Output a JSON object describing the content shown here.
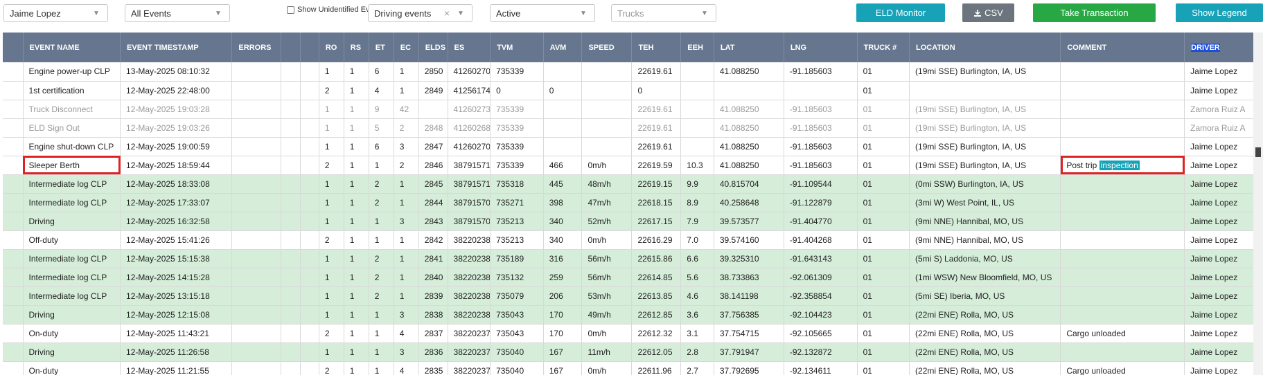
{
  "filters": {
    "driver": "Jaime Lopez",
    "events": "All Events",
    "show_unidentified_label": "Show Unidentified Events",
    "event_type": "Driving events",
    "status": "Active",
    "trucks_placeholder": "Trucks"
  },
  "buttons": {
    "eld_monitor": "ELD Monitor",
    "csv": "CSV",
    "take_transaction": "Take Transaction",
    "show_legend": "Show Legend"
  },
  "colors": {
    "header": "#66768e",
    "row_green": "#d5edd9",
    "highlight": "#d22222",
    "accent_teal": "#17a2b8",
    "accent_green": "#28a745"
  },
  "table": {
    "headers": [
      "",
      "EVENT NAME",
      "EVENT TIMESTAMP",
      "ERRORS",
      "",
      "",
      "RO",
      "RS",
      "ET",
      "EC",
      "ELDS",
      "ES",
      "TVM",
      "AVM",
      "SPEED",
      "TEH",
      "EEH",
      "LAT",
      "LNG",
      "TRUCK #",
      "LOCATION",
      "COMMENT",
      "DRIVER"
    ],
    "rows": [
      {
        "style": "white",
        "cells": [
          "",
          "Engine power-up CLP",
          "13-May-2025 08:10:32",
          "",
          "",
          "",
          "1",
          "1",
          "6",
          "1",
          "2850",
          "41260270",
          "735339",
          "",
          "",
          "22619.61",
          "",
          "41.088250",
          "-91.185603",
          "01",
          "(19mi SSE) Burlington, IA, US",
          "",
          "Jaime Lopez"
        ]
      },
      {
        "style": "white",
        "cells": [
          "",
          "1st certification",
          "12-May-2025 22:48:00",
          "",
          "",
          "",
          "2",
          "1",
          "4",
          "1",
          "2849",
          "41256174",
          "0",
          "0",
          "",
          "0",
          "",
          "",
          "",
          "01",
          "",
          "",
          "Jaime Lopez"
        ]
      },
      {
        "style": "gray",
        "cells": [
          "",
          "Truck Disconnect",
          "12-May-2025 19:03:28",
          "",
          "",
          "",
          "1",
          "1",
          "9",
          "42",
          "",
          "41260273",
          "735339",
          "",
          "",
          "22619.61",
          "",
          "41.088250",
          "-91.185603",
          "01",
          "(19mi SSE) Burlington, IA, US",
          "",
          "Zamora Ruiz A"
        ]
      },
      {
        "style": "gray",
        "cells": [
          "",
          "ELD Sign Out",
          "12-May-2025 19:03:26",
          "",
          "",
          "",
          "1",
          "1",
          "5",
          "2",
          "2848",
          "41260268",
          "735339",
          "",
          "",
          "22619.61",
          "",
          "41.088250",
          "-91.185603",
          "01",
          "(19mi SSE) Burlington, IA, US",
          "",
          "Zamora Ruiz A"
        ]
      },
      {
        "style": "white",
        "cells": [
          "",
          "Engine shut-down CLP",
          "12-May-2025 19:00:59",
          "",
          "",
          "",
          "1",
          "1",
          "6",
          "3",
          "2847",
          "41260270",
          "735339",
          "",
          "",
          "22619.61",
          "",
          "41.088250",
          "-91.185603",
          "01",
          "(19mi SSE) Burlington, IA, US",
          "",
          "Jaime Lopez"
        ]
      },
      {
        "style": "white",
        "cells": [
          "",
          "Sleeper Berth",
          "12-May-2025 18:59:44",
          "",
          "",
          "",
          "2",
          "1",
          "1",
          "2",
          "2846",
          "38791571",
          "735339",
          "466",
          "0m/h",
          "22619.59",
          "10.3",
          "41.088250",
          "-91.185603",
          "01",
          "(19mi SSE) Burlington, IA, US",
          "",
          "Jaime Lopez"
        ],
        "comment_text": "Post trip",
        "comment_chip": "inspection"
      },
      {
        "style": "green",
        "cells": [
          "",
          "Intermediate log CLP",
          "12-May-2025 18:33:08",
          "",
          "",
          "",
          "1",
          "1",
          "2",
          "1",
          "2845",
          "38791571",
          "735318",
          "445",
          "48m/h",
          "22619.15",
          "9.9",
          "40.815704",
          "-91.109544",
          "01",
          "(0mi SSW) Burlington, IA, US",
          "",
          "Jaime Lopez"
        ]
      },
      {
        "style": "green",
        "cells": [
          "",
          "Intermediate log CLP",
          "12-May-2025 17:33:07",
          "",
          "",
          "",
          "1",
          "1",
          "2",
          "1",
          "2844",
          "38791570",
          "735271",
          "398",
          "47m/h",
          "22618.15",
          "8.9",
          "40.258648",
          "-91.122879",
          "01",
          "(3mi W) West Point, IL, US",
          "",
          "Jaime Lopez"
        ]
      },
      {
        "style": "green",
        "cells": [
          "",
          "Driving",
          "12-May-2025 16:32:58",
          "",
          "",
          "",
          "1",
          "1",
          "1",
          "3",
          "2843",
          "38791570",
          "735213",
          "340",
          "52m/h",
          "22617.15",
          "7.9",
          "39.573577",
          "-91.404770",
          "01",
          "(9mi NNE) Hannibal, MO, US",
          "",
          "Jaime Lopez"
        ]
      },
      {
        "style": "white",
        "cells": [
          "",
          "Off-duty",
          "12-May-2025 15:41:26",
          "",
          "",
          "",
          "2",
          "1",
          "1",
          "1",
          "2842",
          "38220238",
          "735213",
          "340",
          "0m/h",
          "22616.29",
          "7.0",
          "39.574160",
          "-91.404268",
          "01",
          "(9mi NNE) Hannibal, MO, US",
          "",
          "Jaime Lopez"
        ]
      },
      {
        "style": "green",
        "cells": [
          "",
          "Intermediate log CLP",
          "12-May-2025 15:15:38",
          "",
          "",
          "",
          "1",
          "1",
          "2",
          "1",
          "2841",
          "38220238",
          "735189",
          "316",
          "56m/h",
          "22615.86",
          "6.6",
          "39.325310",
          "-91.643143",
          "01",
          "(5mi S) Laddonia, MO, US",
          "",
          "Jaime Lopez"
        ]
      },
      {
        "style": "green",
        "cells": [
          "",
          "Intermediate log CLP",
          "12-May-2025 14:15:28",
          "",
          "",
          "",
          "1",
          "1",
          "2",
          "1",
          "2840",
          "38220238",
          "735132",
          "259",
          "56m/h",
          "22614.85",
          "5.6",
          "38.733863",
          "-92.061309",
          "01",
          "(1mi WSW) New Bloomfield, MO, US",
          "",
          "Jaime Lopez"
        ]
      },
      {
        "style": "green",
        "cells": [
          "",
          "Intermediate log CLP",
          "12-May-2025 13:15:18",
          "",
          "",
          "",
          "1",
          "1",
          "2",
          "1",
          "2839",
          "38220238",
          "735079",
          "206",
          "53m/h",
          "22613.85",
          "4.6",
          "38.141198",
          "-92.358854",
          "01",
          "(5mi SE) Iberia, MO, US",
          "",
          "Jaime Lopez"
        ]
      },
      {
        "style": "green",
        "cells": [
          "",
          "Driving",
          "12-May-2025 12:15:08",
          "",
          "",
          "",
          "1",
          "1",
          "1",
          "3",
          "2838",
          "38220238",
          "735043",
          "170",
          "49m/h",
          "22612.85",
          "3.6",
          "37.756385",
          "-92.104423",
          "01",
          "(22mi ENE) Rolla, MO, US",
          "",
          "Jaime Lopez"
        ]
      },
      {
        "style": "white",
        "cells": [
          "",
          "On-duty",
          "12-May-2025 11:43:21",
          "",
          "",
          "",
          "2",
          "1",
          "1",
          "4",
          "2837",
          "38220237",
          "735043",
          "170",
          "0m/h",
          "22612.32",
          "3.1",
          "37.754715",
          "-92.105665",
          "01",
          "(22mi ENE) Rolla, MO, US",
          "Cargo unloaded",
          "Jaime Lopez"
        ]
      },
      {
        "style": "green",
        "cells": [
          "",
          "Driving",
          "12-May-2025 11:26:58",
          "",
          "",
          "",
          "1",
          "1",
          "1",
          "3",
          "2836",
          "38220237",
          "735040",
          "167",
          "11m/h",
          "22612.05",
          "2.8",
          "37.791947",
          "-92.132872",
          "01",
          "(22mi ENE) Rolla, MO, US",
          "",
          "Jaime Lopez"
        ]
      },
      {
        "style": "white",
        "cells": [
          "",
          "On-duty",
          "12-May-2025 11:21:55",
          "",
          "",
          "",
          "2",
          "1",
          "1",
          "4",
          "2835",
          "38220237",
          "735040",
          "167",
          "0m/h",
          "22611.96",
          "2.7",
          "37.792695",
          "-92.134611",
          "01",
          "(22mi ENE) Rolla, MO, US",
          "Cargo unloaded",
          "Jaime Lopez"
        ]
      }
    ]
  }
}
